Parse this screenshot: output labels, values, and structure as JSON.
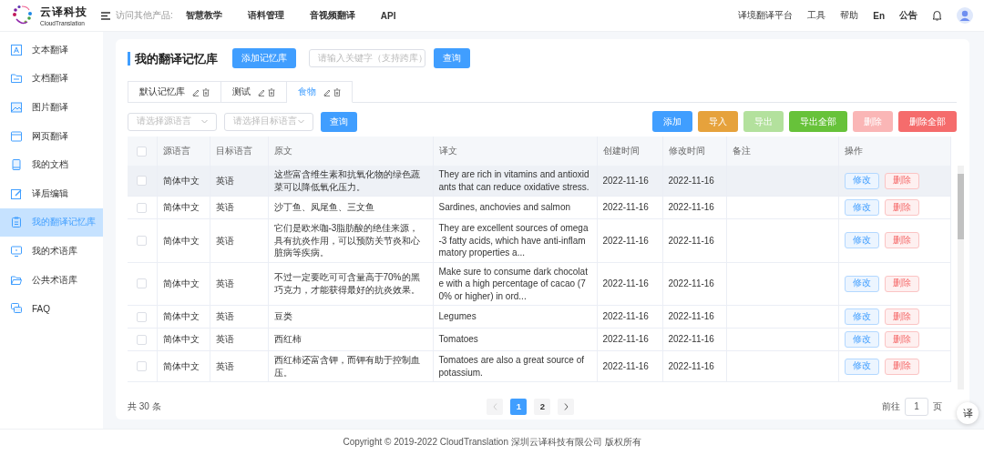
{
  "header": {
    "logo_title": "云译科技",
    "logo_subtitle": "CloudTranslation",
    "products_label": "访问其他产品:",
    "products": [
      "智慧教学",
      "语料管理",
      "音视频翻译",
      "API"
    ],
    "links": [
      "译境翻译平台",
      "工具",
      "帮助"
    ],
    "language": {
      "label": "En",
      "selected": true
    },
    "notice": "公告"
  },
  "sidebar": {
    "items": [
      {
        "label": "文本翻译",
        "selected": false
      },
      {
        "label": "文档翻译",
        "selected": false
      },
      {
        "label": "图片翻译",
        "selected": false
      },
      {
        "label": "网页翻译",
        "selected": false
      },
      {
        "label": "我的文档",
        "selected": false
      },
      {
        "label": "译后编辑",
        "selected": false
      },
      {
        "label": "我的翻译记忆库",
        "selected": true
      },
      {
        "label": "我的术语库",
        "selected": false
      },
      {
        "label": "公共术语库",
        "selected": false
      },
      {
        "label": "FAQ",
        "selected": false
      }
    ]
  },
  "page": {
    "title": "我的翻译记忆库",
    "add_button": "添加记忆库",
    "search": {
      "placeholder": "请输入关键字（支持跨库）"
    },
    "search_button": "查询"
  },
  "memory_tabs": [
    {
      "label": "默认记忆库",
      "selected": false
    },
    {
      "label": "测试",
      "selected": false
    },
    {
      "label": "食物",
      "selected": true
    }
  ],
  "filters": {
    "source": {
      "placeholder": "请选择源语言"
    },
    "target": {
      "placeholder": "请选择目标语言"
    },
    "button": "查询"
  },
  "actions": [
    {
      "label": "添加",
      "kind": "primary",
      "disabled": false
    },
    {
      "label": "导入",
      "kind": "warning",
      "disabled": false
    },
    {
      "label": "导出",
      "kind": "success",
      "disabled": true
    },
    {
      "label": "导出全部",
      "kind": "success",
      "disabled": false
    },
    {
      "label": "删除",
      "kind": "danger",
      "disabled": true
    },
    {
      "label": "删除全部",
      "kind": "danger",
      "disabled": false
    }
  ],
  "table": {
    "select_all_checked": false,
    "columns": [
      "源语言",
      "目标语言",
      "原文",
      "译文",
      "创建时间",
      "修改时间",
      "备注",
      "操作"
    ],
    "rows": [
      {
        "checked": false,
        "hovered": true,
        "source": "简体中文",
        "target": "英语",
        "original": "这些富含维生素和抗氧化物的绿色蔬菜可以降低氧化压力。",
        "translation": "They are rich in vitamins and antioxidants that can reduce oxidative stress.",
        "created": "2022-11-16",
        "modified": "2022-11-16",
        "edit": "修改",
        "delete": "删除"
      },
      {
        "checked": false,
        "hovered": false,
        "source": "简体中文",
        "target": "英语",
        "original": "沙丁鱼、凤尾鱼、三文鱼",
        "translation": "Sardines, anchovies and salmon",
        "created": "2022-11-16",
        "modified": "2022-11-16",
        "edit": "修改",
        "delete": "删除"
      },
      {
        "checked": false,
        "hovered": false,
        "source": "简体中文",
        "target": "英语",
        "original": "它们是欧米咖-3脂肪酸的绝佳来源，具有抗炎作用，可以预防关节炎和心脏病等疾病。",
        "translation": "They are excellent sources of omega-3 fatty acids, which have anti-inflammatory properties a...",
        "created": "2022-11-16",
        "modified": "2022-11-16",
        "edit": "修改",
        "delete": "删除"
      },
      {
        "checked": false,
        "hovered": false,
        "source": "简体中文",
        "target": "英语",
        "original": "不过一定要吃可可含量高于70%的黑巧克力，才能获得最好的抗炎效果。",
        "translation": "Make sure to consume dark chocolate with a high percentage of cacao (70% or higher) in ord...",
        "created": "2022-11-16",
        "modified": "2022-11-16",
        "edit": "修改",
        "delete": "删除"
      },
      {
        "checked": false,
        "hovered": false,
        "source": "简体中文",
        "target": "英语",
        "original": "豆类",
        "translation": "Legumes",
        "created": "2022-11-16",
        "modified": "2022-11-16",
        "edit": "修改",
        "delete": "删除"
      },
      {
        "checked": false,
        "hovered": false,
        "source": "简体中文",
        "target": "英语",
        "original": "西红柿",
        "translation": "Tomatoes",
        "created": "2022-11-16",
        "modified": "2022-11-16",
        "edit": "修改",
        "delete": "删除"
      },
      {
        "checked": false,
        "hovered": false,
        "source": "简体中文",
        "target": "英语",
        "original": "西红柿还富含钾，而钾有助于控制血压。",
        "translation": "Tomatoes are also a great source of potassium.",
        "created": "2022-11-16",
        "modified": "2022-11-16",
        "edit": "修改",
        "delete": "删除"
      }
    ]
  },
  "pagination": {
    "total": "共 30 条",
    "prev_disabled": true,
    "next_disabled": false,
    "pages": [
      {
        "label": "1",
        "selected": true
      },
      {
        "label": "2",
        "selected": false
      }
    ],
    "goto_label": "前往",
    "goto_value": "1",
    "goto_suffix": "页"
  },
  "float_button": "译",
  "footer": "Copyright © 2019-2022 CloudTranslation 深圳云译科技有限公司 版权所有"
}
